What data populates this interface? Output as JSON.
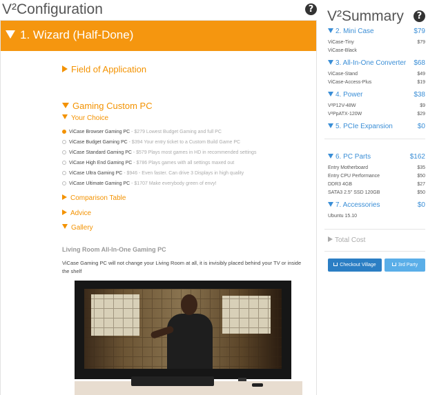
{
  "config_title": "V²Configuration",
  "wizard": {
    "label": "1. Wizard (Half-Done)"
  },
  "sections": {
    "field_of_application": "Field of Application",
    "gaming_custom_pc": "Gaming Custom PC",
    "your_choice": "Your Choice",
    "comparison_table": "Comparison Table",
    "advice": "Advice",
    "gallery": "Gallery"
  },
  "options": [
    {
      "name": "ViCase Browser Gaming PC",
      "desc": " - $279 Lowest Budget Gaming and full PC",
      "selected": true
    },
    {
      "name": "ViCase Budget Gaming PC",
      "desc": " - $394 Your entry ticket to a Custom Build Game PC",
      "selected": false
    },
    {
      "name": "ViCase Standard Gaming PC",
      "desc": " - $579 Plays most games in HD in recommended settings",
      "selected": false
    },
    {
      "name": "ViCase High End Gaming PC",
      "desc": " - $786 Plays games with all settings maxed out",
      "selected": false
    },
    {
      "name": "ViCase Ultra Gaming PC",
      "desc": " - $946 - Even faster. Can drive 3 Displays in high quality",
      "selected": false
    },
    {
      "name": "ViCase Ultimate Gaming PC",
      "desc": " - $1707 Make everybody green of envy!",
      "selected": false
    }
  ],
  "gallery": {
    "title": "Living Room All-In-One Gaming PC",
    "text": "ViCase Gaming PC will not change your Living Room at all, it is invisibly placed behind your TV or inside the shelf"
  },
  "summary": {
    "title": "V²Summary",
    "mini_case": {
      "label": "2. Mini Case",
      "price": "$79",
      "items": [
        {
          "name": "ViCase-Tiny",
          "price": "$79"
        },
        {
          "name": "ViCase-Black",
          "price": ""
        }
      ]
    },
    "converter": {
      "label": "3. All-In-One Converter",
      "price": "$68",
      "items": [
        {
          "name": "ViCase-Stand",
          "price": "$49"
        },
        {
          "name": "ViCase-Access-Plus",
          "price": "$19"
        }
      ]
    },
    "power": {
      "label": "4. Power",
      "price": "$38",
      "items": [
        {
          "name": "V²P12V-48W",
          "price": "$9"
        },
        {
          "name": "V²PpATX-120W",
          "price": "$29"
        }
      ]
    },
    "pcie": {
      "label": "5. PCIe Expansion",
      "price": "$0"
    },
    "pc_parts": {
      "label": "6. PC Parts",
      "price": "$162",
      "items": [
        {
          "name": "Entry Motherboard",
          "price": "$35"
        },
        {
          "name": "Entry CPU Performance",
          "price": "$50"
        },
        {
          "name": "DDR3 4GB",
          "price": "$27"
        },
        {
          "name": "SATA3 2.5\" SSD 120GB",
          "price": "$50"
        }
      ]
    },
    "accessories": {
      "label": "7. Accessories",
      "price": "$0",
      "items": [
        {
          "name": "Ubuntu 15.10",
          "price": ""
        }
      ]
    },
    "total_cost": "Total Cost",
    "checkout_label": "Checkout Village",
    "third_party_label": "3rd Party"
  },
  "colors": {
    "accent_orange": "#f39200",
    "wizard_bar": "#f5960f",
    "summary_blue": "#3a8ed6",
    "button_blue": "#2b7ec4"
  },
  "icons": {
    "help": "question-circle-icon",
    "cart": "cart-icon"
  }
}
